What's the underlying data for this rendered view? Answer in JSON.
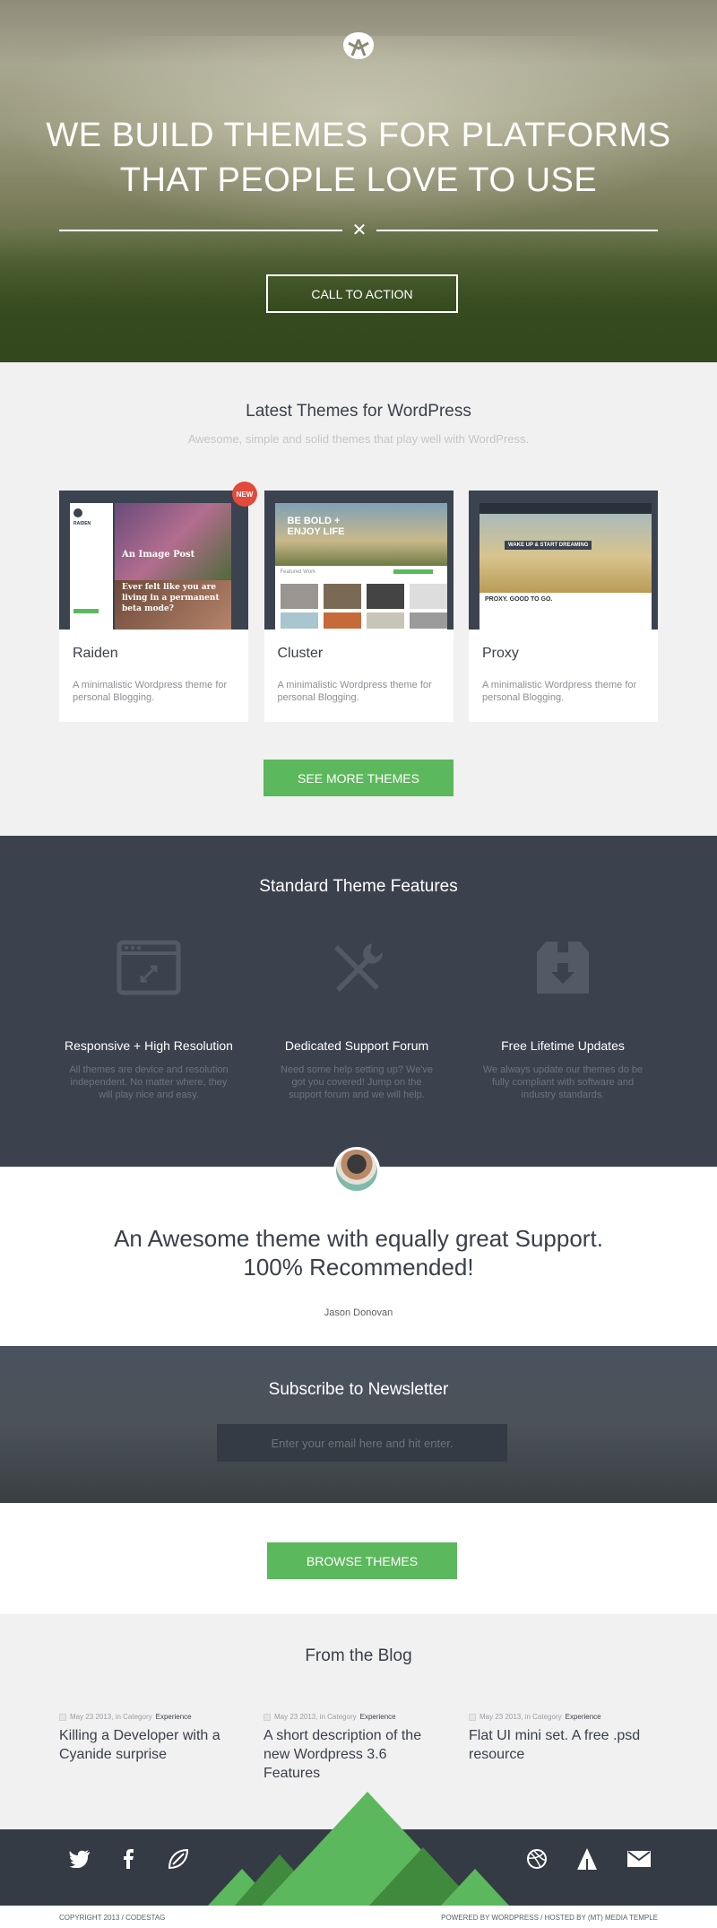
{
  "hero": {
    "headline_line1": "WE BUILD THEMES FOR PLATFORMS",
    "headline_line2": "THAT PEOPLE LOVE TO USE",
    "divider_symbol": "✕",
    "cta_label": "CALL TO ACTION",
    "logo_icon": "brand-logo-icon"
  },
  "themes": {
    "title": "Latest Themes for WordPress",
    "subtitle": "Awesome, simple and solid themes that play well with WordPress.",
    "new_badge": "NEW",
    "cards": [
      {
        "name": "Raiden",
        "description": "A minimalistic Wordpress theme for personal Blogging.",
        "shot_text1": "An Image Post",
        "shot_text2": "Ever felt like you are living in a permanent beta mode?",
        "shot_brand": "RAIDEN"
      },
      {
        "name": "Cluster",
        "description": "A minimalistic Wordpress theme for personal Blogging.",
        "shot_text1": "BE BOLD + ENJOY LIFE",
        "shot_text2": "Featured Work"
      },
      {
        "name": "Proxy",
        "description": "A minimalistic Wordpress theme for personal Blogging.",
        "shot_text1": "WAKE UP & START DREAMING",
        "shot_text2": "PROXY. GOOD TO GO."
      }
    ],
    "more_label": "SEE MORE THEMES"
  },
  "features": {
    "title": "Standard Theme Features",
    "items": [
      {
        "icon": "responsive-window-icon",
        "title": "Responsive + High Resolution",
        "description": "All themes are device and resolution independent. No matter where, they will play nice and easy."
      },
      {
        "icon": "tools-icon",
        "title": "Dedicated Support Forum",
        "description": "Need some help setting up? We've got you covered! Jump on the support forum and we will help."
      },
      {
        "icon": "download-box-icon",
        "title": "Free Lifetime Updates",
        "description": "We always update our themes do be fully compliant with software and industry standards."
      }
    ]
  },
  "testimonial": {
    "quote_line1": "An Awesome theme with equally great Support.",
    "quote_line2": "100% Recommended!",
    "author": "Jason Donovan"
  },
  "newsletter": {
    "title": "Subscribe to Newsletter",
    "placeholder": "Enter your email here and hit enter."
  },
  "browse": {
    "label": "BROWSE THEMES"
  },
  "blog": {
    "title": "From the Blog",
    "posts": [
      {
        "date": "May 23 2013, in Category",
        "category": "Experience",
        "title": "Killing a Developer with a Cyanide surprise"
      },
      {
        "date": "May 23 2013, in Category",
        "category": "Experience",
        "title": "A short description of the new Wordpress 3.6 Features"
      },
      {
        "date": "May 23 2013, in Category",
        "category": "Experience",
        "title": "Flat UI mini set. A free .psd resource"
      }
    ]
  },
  "footer": {
    "social_left": [
      "twitter-icon",
      "facebook-icon",
      "vimeo-leaf-icon"
    ],
    "social_right": [
      "dribbble-icon",
      "forrst-icon",
      "mail-icon"
    ],
    "copyright": "COPYRIGHT 2013 / CODESTAG",
    "powered": "POWERED BY WORDPRESS / HOSTED BY (MT) MEDIA TEMPLE"
  },
  "colors": {
    "accent_green": "#5cb85c",
    "dark_slate": "#3b424d",
    "badge_red": "#e24a3b"
  }
}
